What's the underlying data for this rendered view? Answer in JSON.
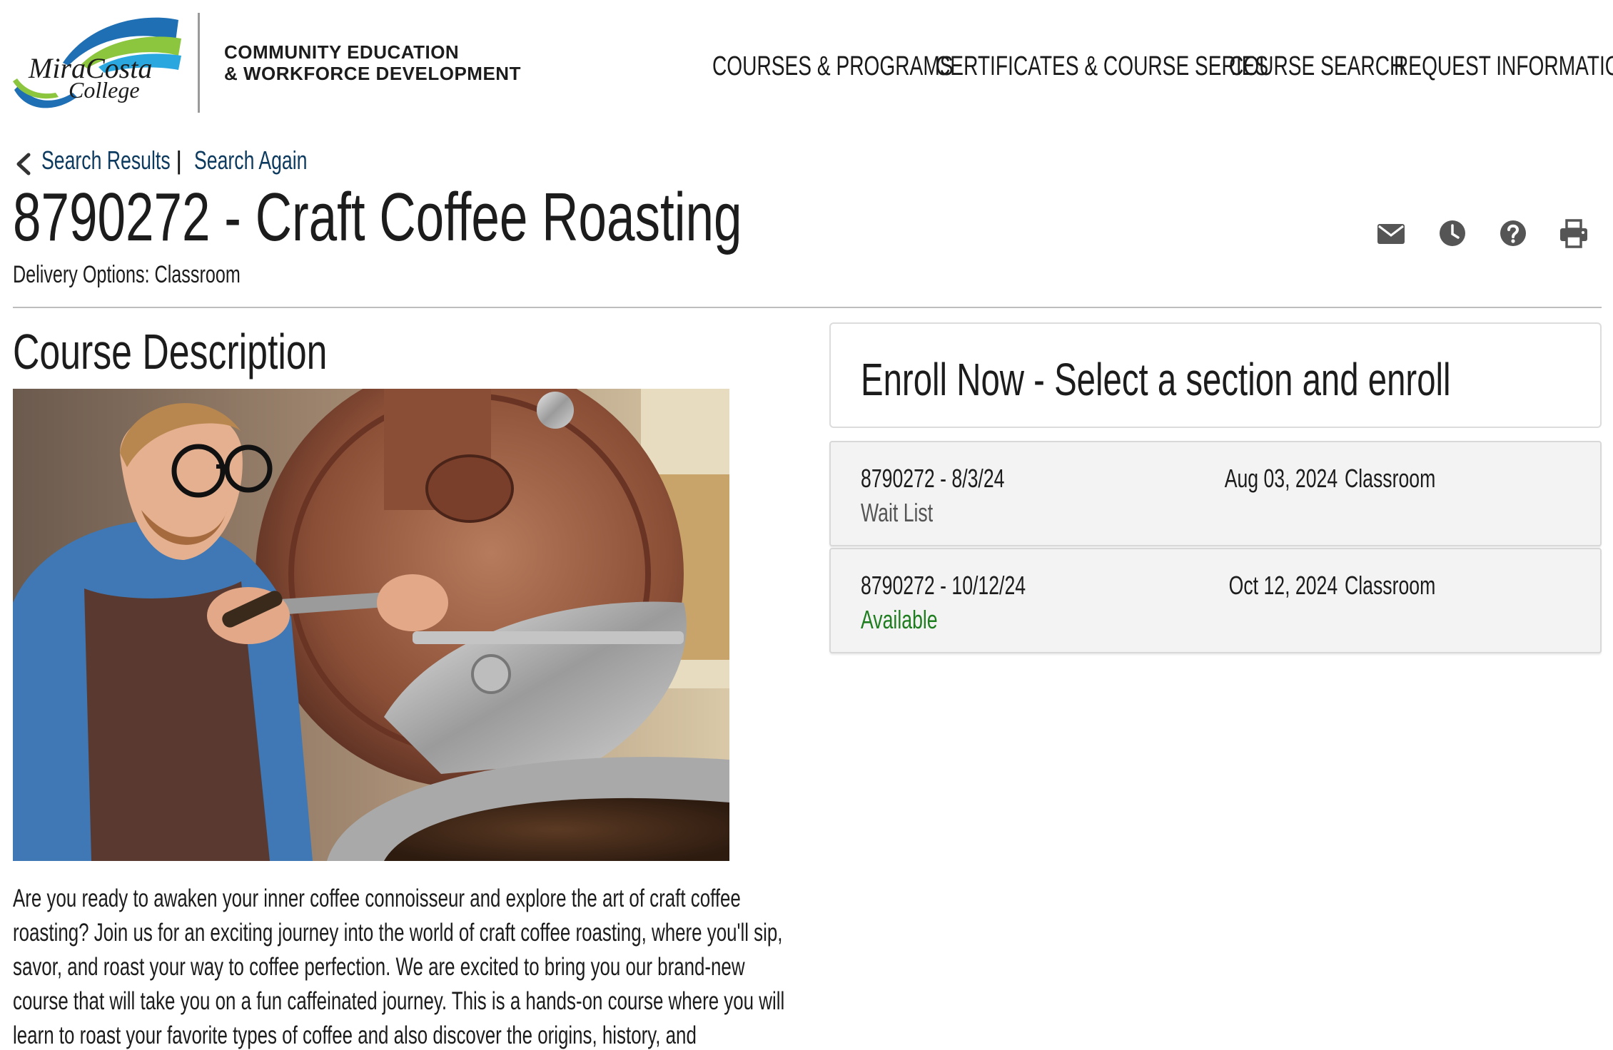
{
  "header": {
    "logo": {
      "line1": "MiraCosta",
      "line2": "College"
    },
    "tagline_line1": "COMMUNITY EDUCATION",
    "tagline_line2": "& WORKFORCE DEVELOPMENT",
    "nav": [
      {
        "label": "COURSES & PROGRAMS"
      },
      {
        "label": "CERTIFICATES & COURSE SERIES"
      },
      {
        "label": "COURSE SEARCH"
      },
      {
        "label": "REQUEST INFORMATION"
      }
    ]
  },
  "breadcrumb": {
    "results_label": "Search Results",
    "separator": "|",
    "again_label": "Search Again"
  },
  "course": {
    "title": "8790272 - Craft Coffee Roasting",
    "delivery": "Delivery Options: Classroom"
  },
  "actions": {
    "icons": [
      "email-icon",
      "clock-icon",
      "help-icon",
      "print-icon"
    ]
  },
  "description": {
    "heading": "Course Description",
    "text": "Are you ready to awaken your inner coffee connoisseur and explore the art of craft coffee roasting? Join us for an exciting journey into the world of craft coffee roasting, where you'll sip, savor, and roast your way to coffee perfection. We are excited to bring you our brand-new course that will take you on a fun caffeinated journey. This is a hands-on course where you will learn to roast your favorite types of coffee and also discover the origins, history, and"
  },
  "enroll": {
    "heading": "Enroll Now - Select a section and enroll",
    "sections": [
      {
        "name": "8790272 - 8/3/24",
        "status": "Wait List",
        "date": "Aug 03, 2024",
        "mode": "Classroom"
      },
      {
        "name": "8790272 - 10/12/24",
        "status": "Available",
        "date": "Oct 12, 2024",
        "mode": "Classroom"
      }
    ]
  },
  "colors": {
    "link": "#0d3a5f",
    "available": "#1e7d1e",
    "waitlist": "#555555",
    "logo_blue": "#1f6fb5",
    "logo_green": "#8cc63f"
  }
}
